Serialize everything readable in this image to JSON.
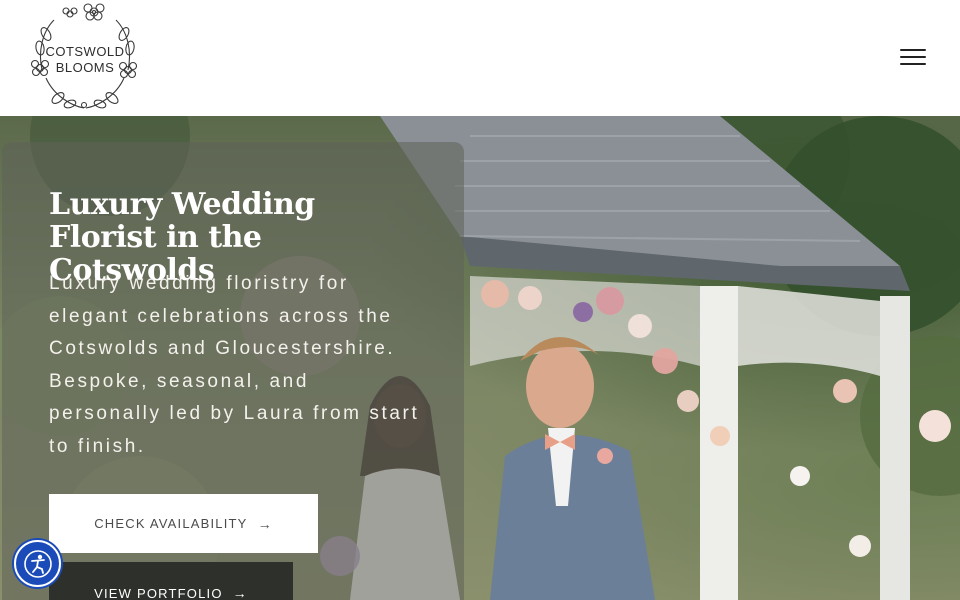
{
  "brand": {
    "logo_line1": "COTSWOLD",
    "logo_line2": "BLOOMS",
    "logo_icon": "floral-wreath-logo"
  },
  "nav": {
    "menu_icon": "hamburger-menu-icon"
  },
  "hero": {
    "title": "Luxury Wedding Florist in the Cotswolds",
    "description": "Luxury wedding floristry for elegant celebrations across the Cotswolds and Gloucestershire. Bespoke, seasonal, and personally led by Laura from start to finish.",
    "primary_cta": "CHECK AVAILABILITY",
    "secondary_cta": "VIEW PORTFOLIO",
    "arrow_icon": "→"
  },
  "accessibility": {
    "icon": "accessibility-icon",
    "color": "#1a4bb8"
  },
  "colors": {
    "overlay": "#5f625a",
    "secondary_button": "#2d302b",
    "text_light": "#ffffff"
  }
}
